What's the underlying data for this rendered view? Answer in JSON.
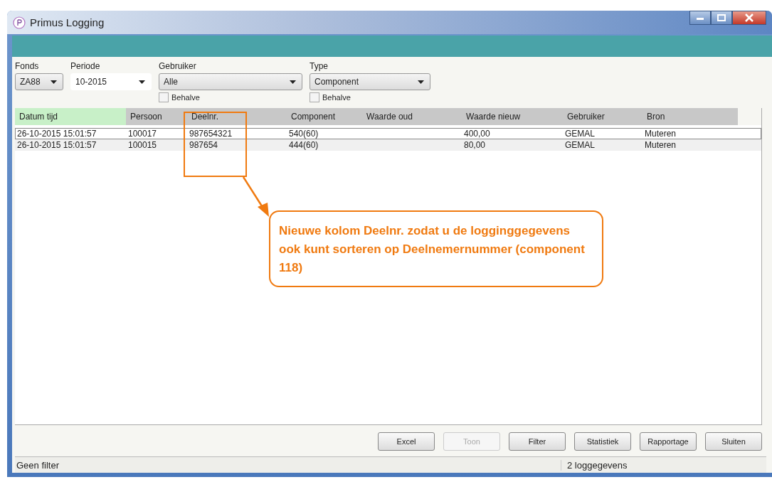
{
  "window": {
    "title": "Primus Logging"
  },
  "filters": [
    {
      "label": "Fonds",
      "value": "ZA88",
      "kind": "combo"
    },
    {
      "label": "Periode",
      "value": "10-2015",
      "kind": "flat"
    },
    {
      "label": "Gebruiker",
      "value": "Alle",
      "kind": "combo",
      "except": {
        "label": "Behalve",
        "checked": false
      }
    },
    {
      "label": "Type",
      "value": "Component",
      "kind": "combo",
      "except": {
        "label": "Behalve",
        "checked": false
      }
    }
  ],
  "table": {
    "columns": [
      {
        "label": "Datum tijd",
        "sorted": true
      },
      {
        "label": "Persoon",
        "sorted": false
      },
      {
        "label": "Deelnr.",
        "sorted": false
      },
      {
        "label": "Component",
        "sorted": false
      },
      {
        "label": "Waarde oud",
        "sorted": false
      },
      {
        "label": "Waarde nieuw",
        "sorted": false
      },
      {
        "label": "Gebruiker",
        "sorted": false
      },
      {
        "label": "Bron",
        "sorted": false
      }
    ],
    "rows": [
      {
        "selected": true,
        "cells": [
          "26-10-2015 15:01:57",
          "100017",
          "987654321",
          "540(60)",
          "",
          "400,00",
          "GEMAL",
          "Muteren"
        ]
      },
      {
        "selected": false,
        "cells": [
          "26-10-2015 15:01:57",
          "100015",
          "987654",
          "444(60)",
          "",
          "80,00",
          "GEMAL",
          "Muteren"
        ]
      }
    ]
  },
  "callout": {
    "text": "Nieuwe kolom Deelnr. zodat u de logginggegevens ook kunt sorteren op Deelnemernummer (component 118)"
  },
  "buttons": [
    {
      "label": "Excel",
      "disabled": false
    },
    {
      "label": "Toon",
      "disabled": true
    },
    {
      "label": "Filter",
      "disabled": false
    },
    {
      "label": "Statistiek",
      "disabled": false
    },
    {
      "label": "Rapportage",
      "disabled": false
    },
    {
      "label": "Sluiten",
      "disabled": false
    }
  ],
  "status_bar": {
    "left": "Geen filter",
    "right": "2 loggegevens"
  }
}
